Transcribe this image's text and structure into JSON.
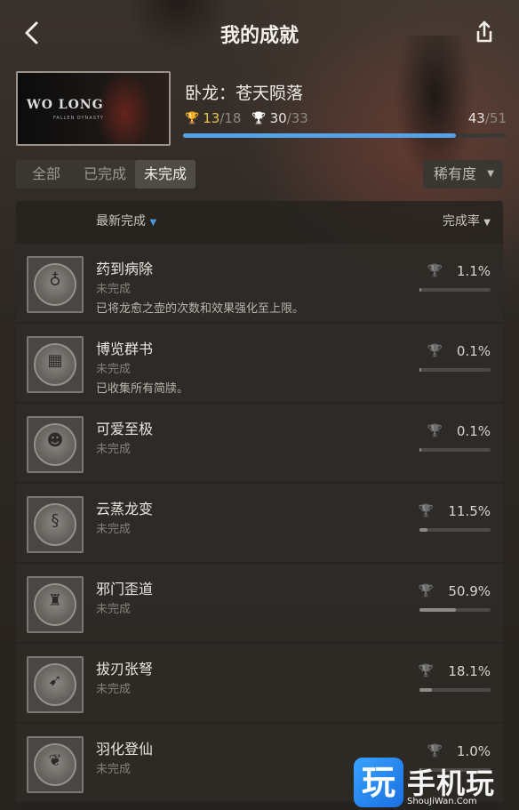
{
  "header": {
    "title": "我的成就",
    "back_icon": "chevron-left-icon",
    "share_icon": "share-icon"
  },
  "game": {
    "title": "卧龙：苍天陨落",
    "cover_logo": "WO LONG",
    "cover_sub": "FALLEN DYNASTY",
    "gold_earned": "13",
    "gold_total": "/18",
    "silver_earned": "30",
    "silver_total": "/33",
    "completed": "43",
    "total": "/51",
    "progress_fraction": 0.843
  },
  "filters": {
    "tabs": [
      "全部",
      "已完成",
      "未完成"
    ],
    "active_index": 2,
    "rarity_label": "稀有度"
  },
  "sort": {
    "latest_label": "最新完成",
    "rate_label": "完成率"
  },
  "achievements": [
    {
      "name": "药到病除",
      "status": "未完成",
      "desc": "已将龙愈之壶的次数和效果强化至上限。",
      "rate": "1.1%",
      "rate_value": 1.1,
      "icon": "gourd-icon"
    },
    {
      "name": "博览群书",
      "status": "未完成",
      "desc": "已收集所有简牍。",
      "rate": "0.1%",
      "rate_value": 0.1,
      "icon": "scroll-icon"
    },
    {
      "name": "可爱至极",
      "status": "未完成",
      "desc": "",
      "rate": "0.1%",
      "rate_value": 0.1,
      "icon": "creature-icon"
    },
    {
      "name": "云蒸龙变",
      "status": "未完成",
      "desc": "",
      "rate": "11.5%",
      "rate_value": 11.5,
      "icon": "dragon-icon"
    },
    {
      "name": "邪门歪道",
      "status": "未完成",
      "desc": "",
      "rate": "50.9%",
      "rate_value": 50.9,
      "icon": "warrior-icon"
    },
    {
      "name": "拔刃张弩",
      "status": "未完成",
      "desc": "",
      "rate": "18.1%",
      "rate_value": 18.1,
      "icon": "crossbow-icon"
    },
    {
      "name": "羽化登仙",
      "status": "未完成",
      "desc": "",
      "rate": "1.0%",
      "rate_value": 1.0,
      "icon": "feather-icon"
    }
  ],
  "watermark": {
    "glyph": "玩",
    "text": "手机玩",
    "url": "ShouJiWan.Com"
  },
  "colors": {
    "accent": "#54a3e8",
    "gold": "#e8c24a"
  }
}
